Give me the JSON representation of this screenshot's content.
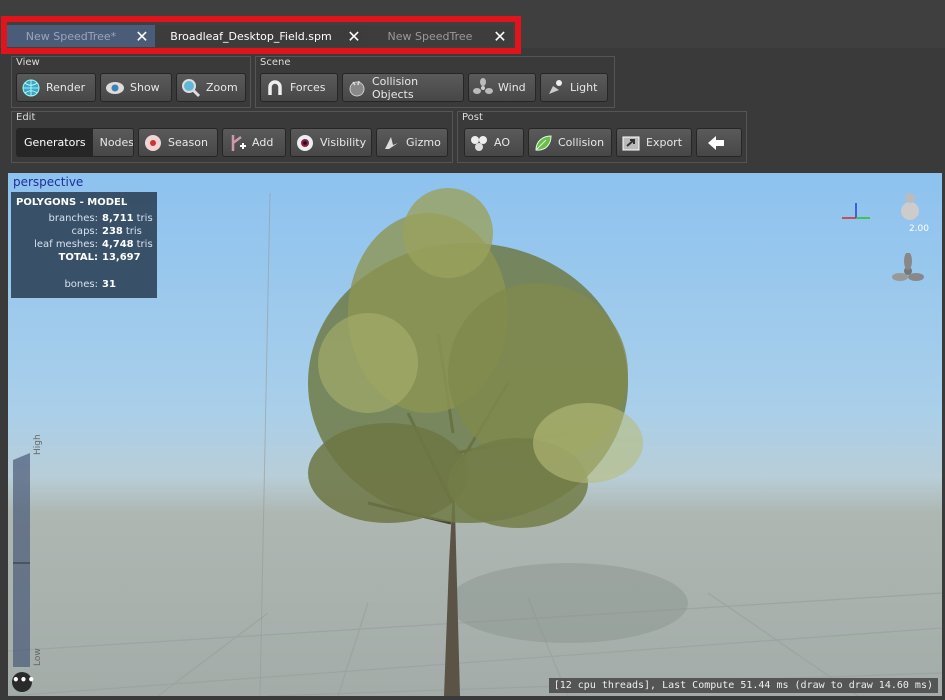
{
  "tabs": [
    {
      "label": "New SpeedTree*",
      "active": false
    },
    {
      "label": "Broadleaf_Desktop_Field.spm",
      "active": true
    },
    {
      "label": "New SpeedTree",
      "active": false
    }
  ],
  "toolbar": {
    "view": {
      "title": "View",
      "buttons": [
        "Render",
        "Show",
        "Zoom"
      ]
    },
    "scene": {
      "title": "Scene",
      "buttons": [
        "Forces",
        "Collision Objects",
        "Wind",
        "Light"
      ]
    },
    "edit": {
      "title": "Edit",
      "segments": [
        "Generators",
        "Nodes"
      ],
      "buttons": [
        "Season",
        "Add",
        "Visibility",
        "Gizmo"
      ]
    },
    "post": {
      "title": "Post",
      "buttons": [
        "AO",
        "Collision",
        "Export"
      ]
    }
  },
  "viewport": {
    "label": "perspective",
    "stats": {
      "title": "POLYGONS - MODEL",
      "branches_label": "branches:",
      "branches_value": "8,711",
      "branches_unit": "tris",
      "caps_label": "caps:",
      "caps_value": "238",
      "caps_unit": "tris",
      "leaf_label": "leaf meshes:",
      "leaf_value": "4,748",
      "leaf_unit": "tris",
      "total_label": "TOTAL:",
      "total_value": "13,697",
      "bones_label": "bones:",
      "bones_value": "31"
    },
    "camera_zoom": "2.00",
    "lod_high": "High",
    "lod_low": "Low",
    "status": "[12 cpu threads], Last Compute 51.44 ms (draw to draw 14.60 ms)"
  },
  "colors": {
    "highlight": "#e0141a",
    "sky": "#8dc2ef",
    "ground": "#a3aca8"
  }
}
